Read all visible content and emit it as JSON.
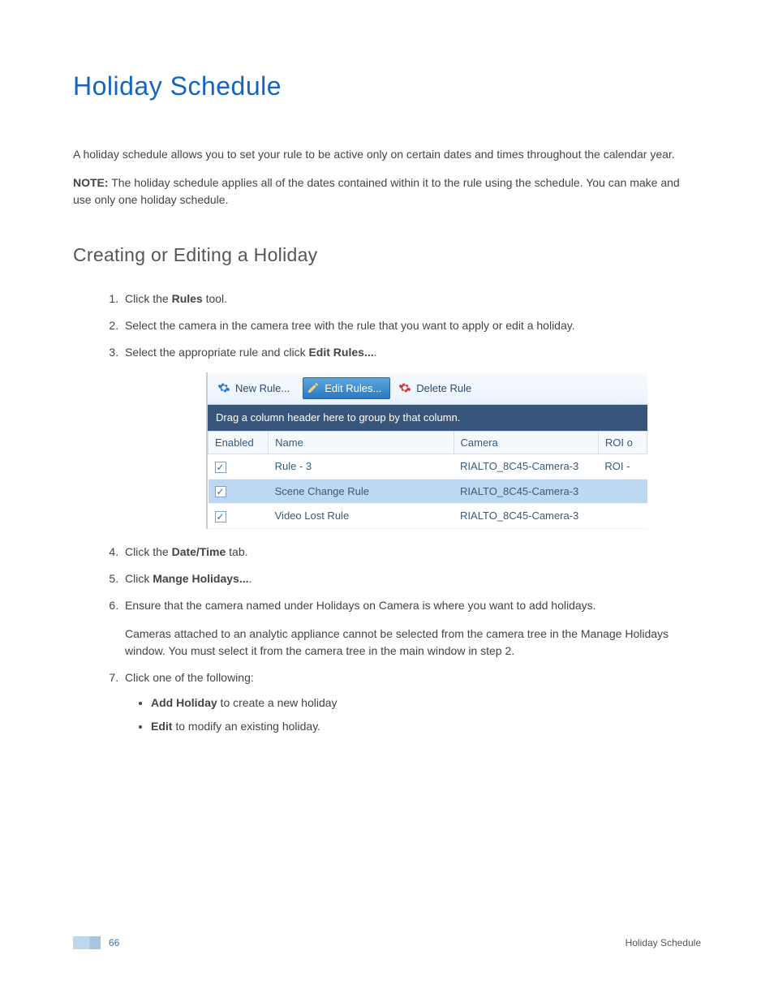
{
  "title": "Holiday Schedule",
  "intro": "A holiday schedule allows you to set your rule to be active only on certain dates and times throughout the calendar year.",
  "note_label": "NOTE:",
  "note_text": " The holiday schedule applies all of the dates contained within it to the rule using the schedule. You can make and use only one holiday schedule.",
  "subtitle": "Creating or Editing a Holiday",
  "steps": {
    "s1_a": "Click the ",
    "s1_b": "Rules",
    "s1_c": " tool.",
    "s2": "Select the camera in the camera tree with the rule that you want to apply or edit a holiday.",
    "s3_a": "Select the appropriate rule and click ",
    "s3_b": "Edit Rules...",
    "s3_c": ".",
    "s4_a": "Click the ",
    "s4_b": "Date/Time",
    "s4_c": " tab.",
    "s5_a": "Click ",
    "s5_b": "Mange Holidays...",
    "s5_c": ".",
    "s6": "Ensure that the camera named under Holidays on Camera is where you want to add holidays.",
    "s6_para": "Cameras attached to an analytic appliance cannot be selected from the camera tree in the Manage Holidays window. You must select it from the camera tree in the main window in step 2.",
    "s7": "Click one of the following:",
    "s7_b1_a": "Add Holiday",
    "s7_b1_b": " to create a new holiday",
    "s7_b2_a": "Edit",
    "s7_b2_b": " to modify an existing holiday."
  },
  "screenshot": {
    "toolbar": {
      "new_rule": "New Rule...",
      "edit_rules": "Edit Rules...",
      "delete_rule": "Delete Rule"
    },
    "group_hint": "Drag a column header here to group by that column.",
    "columns": {
      "enabled": "Enabled",
      "name": "Name",
      "camera": "Camera",
      "roi": "ROI o"
    },
    "rows": [
      {
        "name": "Rule - 3",
        "camera": "RIALTO_8C45-Camera-3",
        "roi": "ROI -"
      },
      {
        "name": "Scene Change Rule",
        "camera": "RIALTO_8C45-Camera-3",
        "roi": ""
      },
      {
        "name": "Video Lost Rule",
        "camera": "RIALTO_8C45-Camera-3",
        "roi": ""
      }
    ]
  },
  "footer": {
    "page": "66",
    "section": "Holiday Schedule"
  }
}
